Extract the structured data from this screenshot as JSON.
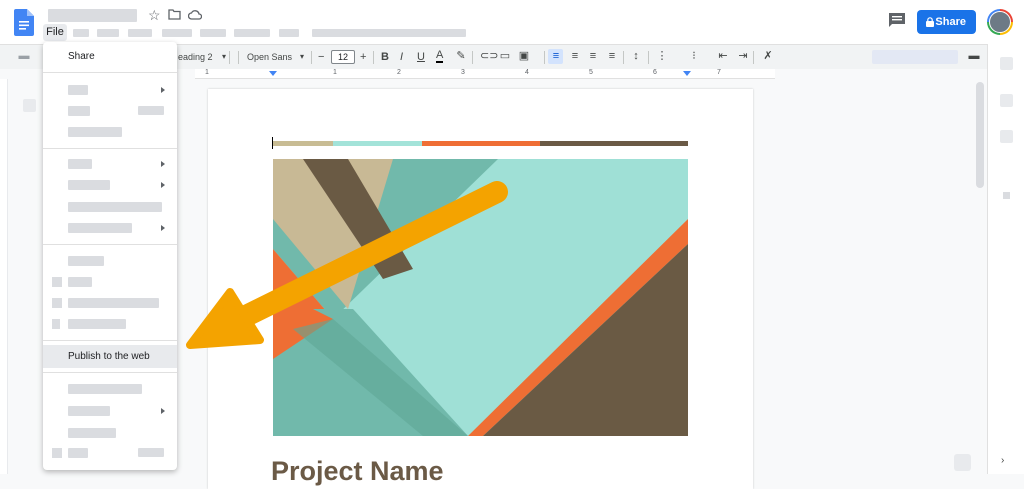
{
  "app": {
    "menu_file": "File",
    "share_label": "Share"
  },
  "toolbar": {
    "style_label": "eading 2",
    "font_label": "Open Sans",
    "font_size": "12",
    "minus": "−",
    "plus": "+",
    "bold": "B",
    "italic": "I",
    "underline": "U",
    "textcolor": "A"
  },
  "ruler_marks": [
    "1",
    "1",
    "2",
    "3",
    "4",
    "5",
    "6",
    "7"
  ],
  "file_menu": {
    "share": "Share",
    "publish": "Publish to the web"
  },
  "document": {
    "title": "Project Name",
    "color_bar": [
      "#c8bc94",
      "#a3e3d9",
      "#ef6e35",
      "#6b5a46"
    ]
  },
  "icons": [
    "docs-icon",
    "star-icon",
    "folder-icon",
    "cloud-icon",
    "comment-icon",
    "lock-icon"
  ]
}
